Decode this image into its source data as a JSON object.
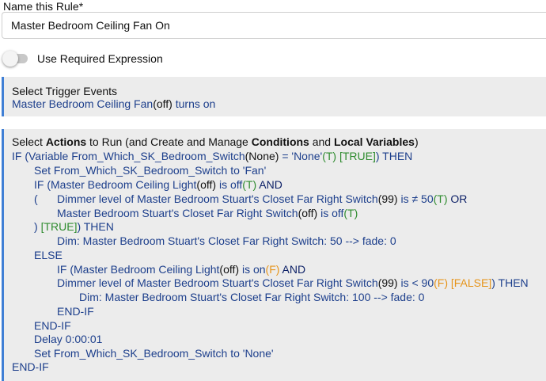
{
  "name_rule": {
    "label": "Name this Rule*",
    "value": "Master Bedroom Ceiling Fan On"
  },
  "required_expression": {
    "label": "Use Required Expression",
    "enabled": false
  },
  "trigger": {
    "title": "Select Trigger Events",
    "device": "Master Bedroom Ceiling Fan",
    "state": "off",
    "action": "turns on"
  },
  "actions": {
    "title_pre": "Select ",
    "title_b1": "Actions",
    "title_mid1": " to Run (and Create and Manage ",
    "title_b2": "Conditions",
    "title_mid2": " and ",
    "title_b3": "Local Variables",
    "title_post": ")",
    "l1_a": "IF (Variable From_Which_SK_Bedroom_Switch",
    "l1_b": "(None)",
    "l1_c": " = 'None'",
    "l1_d": "(T) [TRUE]",
    "l1_e": ") THEN",
    "l2": "Set From_Which_SK_Bedroom_Switch to 'Fan'",
    "l3_a": "IF (Master Bedroom Ceiling Light",
    "l3_b": "(off)",
    "l3_c": " is off",
    "l3_d": "(T)",
    "l3_e": "  AND",
    "l4_a": "(",
    "l4_b": "Dimmer level of Master Bedroom Stuart's Closet Far Right Switch",
    "l4_c": "(99)",
    "l4_d": " is ≠ 50",
    "l4_e": "(T)",
    "l4_f": "  OR",
    "l5_a": "Master Bedroom Stuart's Closet Far Right Switch",
    "l5_b": "(off)",
    "l5_c": " is off",
    "l5_d": "(T)",
    "l6_a": ") ",
    "l6_b": "[TRUE]",
    "l6_c": ") THEN",
    "l7": "Dim: Master Bedroom Stuart's Closet Far Right Switch: 50 --> fade: 0",
    "l8": "ELSE",
    "l9_a": "IF (Master Bedroom Ceiling Light",
    "l9_b": "(off)",
    "l9_c": " is on",
    "l9_d": "(F)",
    "l9_e": "  AND",
    "l10_a": "Dimmer level of Master Bedroom Stuart's Closet Far Right Switch",
    "l10_b": "(99)",
    "l10_c": " is < 90",
    "l10_d": "(F) [FALSE]",
    "l10_e": ") THEN",
    "l11": "Dim: Master Bedroom Stuart's Closet Far Right Switch: 100 --> fade: 0",
    "l12": "END-IF",
    "l13": "END-IF",
    "l14": "Delay 0:00:01",
    "l15": "Set From_Which_SK_Bedroom_Switch to 'None'",
    "l16": "END-IF"
  }
}
